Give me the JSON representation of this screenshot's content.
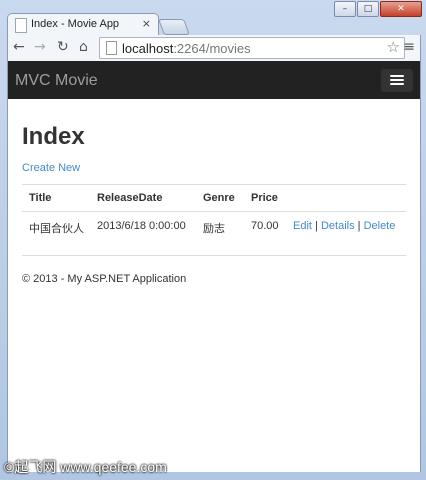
{
  "browser": {
    "tab_title": "Index - Movie App",
    "tab_close": "×",
    "url_host": "localhost",
    "url_rest": ":2264/movies",
    "window_controls": {
      "minimize": "–",
      "maximize": "□",
      "close": "✕"
    },
    "icons": {
      "back": "arrow-left-icon",
      "forward": "arrow-right-icon",
      "reload": "reload-icon",
      "home": "home-icon",
      "star": "star-icon",
      "menu": "menu-icon"
    }
  },
  "site": {
    "brand": "MVC Movie",
    "nav_color": "#222222",
    "link_color": "#428bca"
  },
  "page": {
    "heading": "Index",
    "create_link": "Create New",
    "table": {
      "headers": [
        "Title",
        "ReleaseDate",
        "Genre",
        "Price"
      ],
      "rows": [
        {
          "title": "中国合伙人",
          "release_date": "2013/6/18 0:00:00",
          "genre": "励志",
          "price": "70.00",
          "edit": "Edit",
          "details": "Details",
          "delete": "Delete",
          "sep": "|"
        }
      ]
    },
    "footer": "© 2013 - My ASP.NET Application"
  },
  "watermark": "©起飞网  www.qeefee.com"
}
